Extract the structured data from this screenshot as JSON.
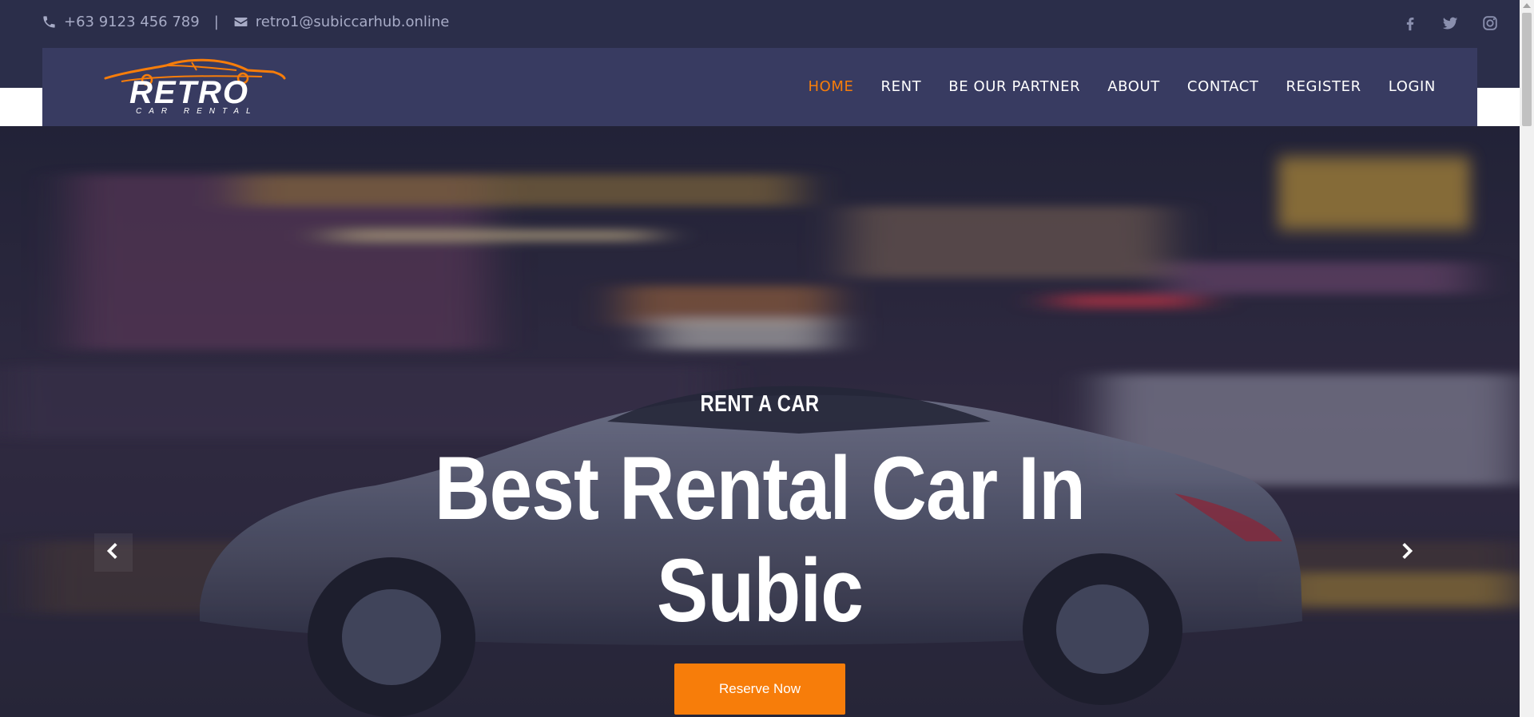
{
  "topbar": {
    "phone": "+63 9123 456 789",
    "separator": "|",
    "email": "retro1@subiccarhub.online",
    "icons": {
      "phone": "phone-icon",
      "email": "envelope-icon"
    },
    "social": [
      "facebook-icon",
      "twitter-icon",
      "instagram-icon"
    ]
  },
  "logo": {
    "name": "RETRO",
    "tagline": "CAR RENTAL"
  },
  "nav": {
    "items": [
      {
        "label": "HOME",
        "active": true
      },
      {
        "label": "RENT"
      },
      {
        "label": "BE OUR PARTNER"
      },
      {
        "label": "ABOUT"
      },
      {
        "label": "CONTACT"
      },
      {
        "label": "REGISTER"
      },
      {
        "label": "LOGIN"
      }
    ]
  },
  "hero": {
    "kicker": "RENT A CAR",
    "headline": "Best Rental Car In Subic",
    "cta": "Reserve Now",
    "prev_icon": "chevron-left-icon",
    "next_icon": "chevron-right-icon"
  },
  "colors": {
    "accent": "#f77d0a",
    "topbar_bg": "#2b2e4a",
    "navbar_bg": "#383b61",
    "text_muted": "#a7abc6"
  }
}
